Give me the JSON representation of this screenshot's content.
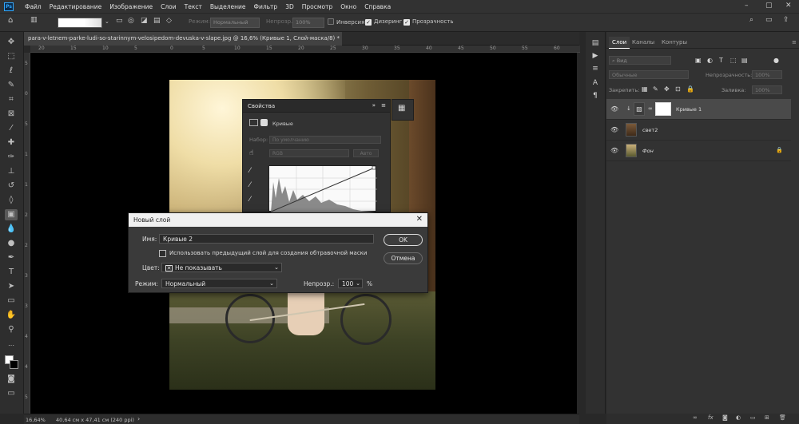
{
  "menubar": {
    "items": [
      "Файл",
      "Редактирование",
      "Изображение",
      "Слои",
      "Текст",
      "Выделение",
      "Фильтр",
      "3D",
      "Просмотр",
      "Окно",
      "Справка"
    ],
    "logo": "Ps"
  },
  "options": {
    "mode_label": "Режим:",
    "mode_value": "Нормальный",
    "opacity_label": "Непрозр.:",
    "opacity_value": "100%",
    "reverse_label": "Инверсия",
    "dither_label": "Дизеринг",
    "transparency_label": "Прозрачность",
    "reverse_checked": false,
    "dither_checked": true,
    "transparency_checked": true
  },
  "doc_tab": {
    "title": "para-v-letnem-parke-ludi-so-starinnym-velosipedom-devuska-v-slape.jpg @ 16,6% (Кривые 1, Слой-маска/8) *",
    "close": "×"
  },
  "rulers": {
    "top": [
      "20",
      "15",
      "10",
      "5",
      "0",
      "5",
      "10",
      "15",
      "20",
      "25",
      "30",
      "35",
      "40",
      "45",
      "50",
      "55",
      "60"
    ],
    "left": [
      "5",
      "0",
      "5",
      "1",
      "1",
      "2",
      "2",
      "3",
      "3",
      "4",
      "4",
      "5"
    ]
  },
  "properties": {
    "title": "Свойства",
    "layer_type": "Кривые",
    "preset_label": "Набор:",
    "preset_value": "По умолчанию",
    "channel": "RGB",
    "auto_button": "Авто"
  },
  "dialog": {
    "title": "Новый слой",
    "name_label": "Имя:",
    "name_value": "Кривые 2",
    "clip_label": "Использовать предыдущий слой для создания обтравочной маски",
    "color_label": "Цвет:",
    "color_value": "Не показывать",
    "mode_label": "Режим:",
    "mode_value": "Нормальный",
    "opacity_label": "Непрозр.:",
    "opacity_value": "100",
    "percent": "%",
    "ok": "OK",
    "cancel": "Отмена"
  },
  "layers_panel": {
    "tabs": [
      "Слои",
      "Каналы",
      "Контуры"
    ],
    "search_placeholder": "Вид",
    "blend_mode": "Обычные",
    "opacity_label": "Непрозрачность:",
    "opacity_value": "100%",
    "lock_label": "Закрепить:",
    "fill_label": "Заливка:",
    "fill_value": "100%",
    "layers": [
      {
        "name": "Кривые 1",
        "selected": true
      },
      {
        "name": "свет2",
        "selected": false
      },
      {
        "name": "Фон",
        "selected": false
      }
    ]
  },
  "status": {
    "zoom": "16,64%",
    "doc_size": "40,64 см x 47,41 см (240 ppi)"
  },
  "colors": {
    "accent": "#31a8ff",
    "panel": "#323232",
    "arrow": "#e01b24"
  }
}
